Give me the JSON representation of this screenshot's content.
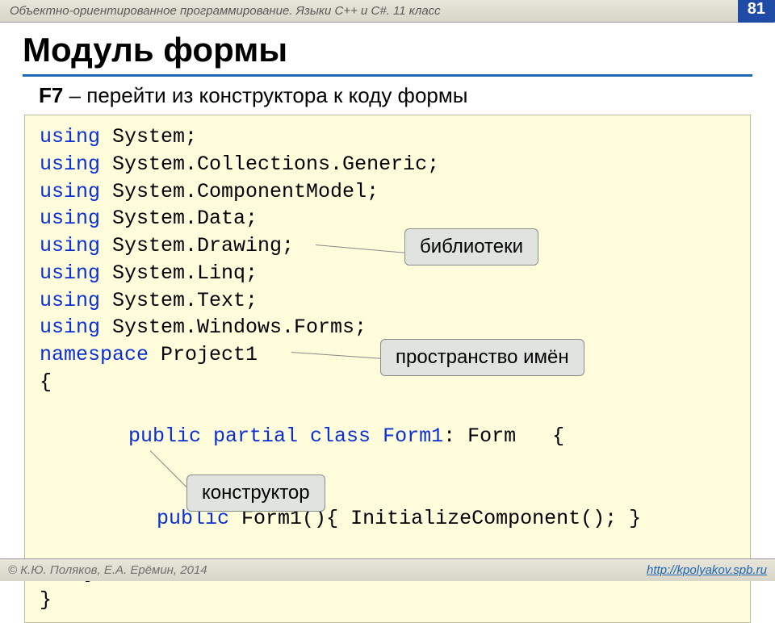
{
  "header": {
    "chapter": "Объектно-ориентированное программирование. Языки C++ и C#. 11 класс",
    "page_number": "81"
  },
  "title": "Модуль формы",
  "subtitle": {
    "key": "F7",
    "rest": " – перейти из конструктора к коду формы"
  },
  "code": {
    "lines": [
      [
        {
          "t": "using ",
          "c": "kw"
        },
        {
          "t": "System;",
          "c": "bl"
        }
      ],
      [
        {
          "t": "using ",
          "c": "kw"
        },
        {
          "t": "System.Collections.Generic;",
          "c": "bl"
        }
      ],
      [
        {
          "t": "using ",
          "c": "kw"
        },
        {
          "t": "System.ComponentModel;",
          "c": "bl"
        }
      ],
      [
        {
          "t": "using ",
          "c": "kw"
        },
        {
          "t": "System.Data;",
          "c": "bl"
        }
      ],
      [
        {
          "t": "using ",
          "c": "kw"
        },
        {
          "t": "System.Drawing;",
          "c": "bl"
        }
      ],
      [
        {
          "t": "using ",
          "c": "kw"
        },
        {
          "t": "System.Linq;",
          "c": "bl"
        }
      ],
      [
        {
          "t": "using ",
          "c": "kw"
        },
        {
          "t": "System.Text;",
          "c": "bl"
        }
      ],
      [
        {
          "t": "using ",
          "c": "kw"
        },
        {
          "t": "System.Windows.Forms;",
          "c": "bl"
        }
      ],
      [
        {
          "t": "namespace ",
          "c": "kw"
        },
        {
          "t": "Project1",
          "c": "bl"
        }
      ],
      [
        {
          "t": "{",
          "c": "bl"
        }
      ]
    ],
    "class_line": {
      "pre": "public partial class ",
      "name": "Form1",
      "post": ": Form   {"
    },
    "ctor_line": {
      "a": "public ",
      "b": "Form1(){ InitializeComponent(); }"
    },
    "close1": "}",
    "close2": "}"
  },
  "callouts": {
    "libs": "библиотеки",
    "ns": "пространство имён",
    "ctor": "конструктор"
  },
  "footer": {
    "copyright": "© К.Ю. Поляков, Е.А. Ерёмин, 2014",
    "url": "http://kpolyakov.spb.ru"
  }
}
